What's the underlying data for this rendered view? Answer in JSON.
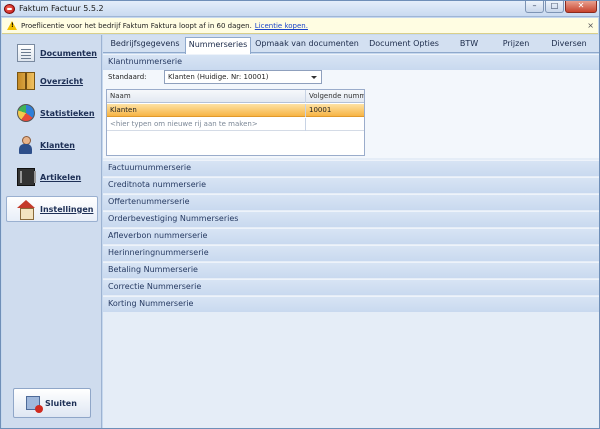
{
  "window": {
    "title": "Faktum Factuur 5.5.2",
    "min_glyph": "–",
    "max_glyph": "□",
    "close_glyph": "✕"
  },
  "infobar": {
    "text": "Proeflicentie voor het bedrijf Faktum Faktura loopt af in 60 dagen.",
    "link": "Licentie kopen.",
    "close_glyph": "×"
  },
  "sidebar": {
    "items": [
      {
        "label": "Documenten",
        "icon": "document-icon"
      },
      {
        "label": "Overzicht",
        "icon": "book-icon"
      },
      {
        "label": "Statistieken",
        "icon": "pie-chart-icon"
      },
      {
        "label": "Klanten",
        "icon": "person-icon"
      },
      {
        "label": "Artikelen",
        "icon": "box-icon"
      },
      {
        "label": "Instellingen",
        "icon": "house-icon",
        "active": true
      }
    ],
    "close_button": "Sluiten"
  },
  "tabs": [
    {
      "label": "Bedrijfsgegevens"
    },
    {
      "label": "Nummerseries",
      "active": true
    },
    {
      "label": "Opmaak van documenten"
    },
    {
      "label": "Document Opties"
    },
    {
      "label": "BTW"
    },
    {
      "label": "Prijzen"
    },
    {
      "label": "Diversen"
    }
  ],
  "klant_section": {
    "title": "Klantnummerserie",
    "standard_label": "Standaard:",
    "standard_value": "Klanten (Huidige. Nr: 10001)",
    "grid": {
      "columns": [
        "Naam",
        "Volgende nummer"
      ],
      "rows": [
        {
          "naam": "Klanten",
          "volgende": "10001"
        }
      ],
      "new_row_placeholder": "<hier typen om nieuwe rij aan te maken>"
    }
  },
  "collapsed_sections": [
    "Factuurnummerserie",
    "Creditnota nummerserie",
    "Offertenummerserie",
    "Orderbevestiging Nummerseries",
    "Afleverbon nummerserie",
    "Herinneringnummerserie",
    "Betaling Nummerserie",
    "Correctie Nummerserie",
    "Korting Nummerserie"
  ],
  "colors": {
    "accent": "#f7b445",
    "panel": "#c9d9ef",
    "window": "#c6d8ee"
  }
}
